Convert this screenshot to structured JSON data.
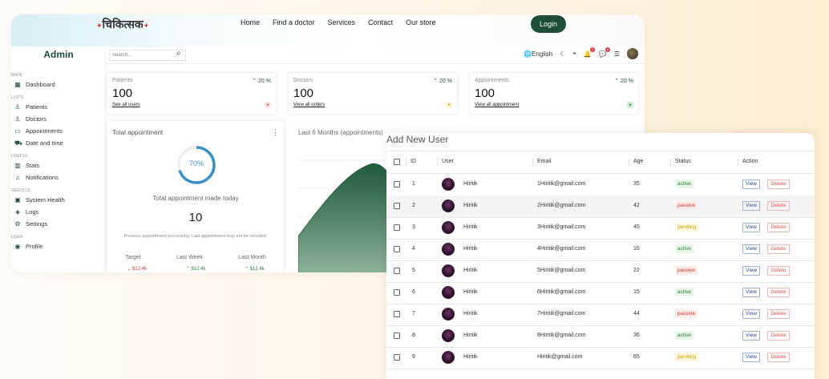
{
  "brand": {
    "logo": "चिकित्सक",
    "login": "Login"
  },
  "nav": [
    "Home",
    "Find a doctor",
    "Services",
    "Contact",
    "Our store"
  ],
  "sidebar": {
    "title": "Admin",
    "sections": [
      {
        "label": "MAIN",
        "items": [
          {
            "label": "Dashboard",
            "icon": "dashboard-icon"
          }
        ]
      },
      {
        "label": "LISTS",
        "items": [
          {
            "label": "Patients",
            "icon": "person-icon"
          },
          {
            "label": "Doctors",
            "icon": "doctor-icon"
          },
          {
            "label": "Appointments",
            "icon": "card-icon"
          },
          {
            "label": "Date and time",
            "icon": "truck-icon"
          }
        ]
      },
      {
        "label": "USEFUL",
        "items": [
          {
            "label": "Stats",
            "icon": "stats-icon"
          },
          {
            "label": "Notifications",
            "icon": "bell-icon"
          }
        ]
      },
      {
        "label": "SERVICE",
        "items": [
          {
            "label": "System Health",
            "icon": "health-icon"
          },
          {
            "label": "Logs",
            "icon": "logs-icon"
          },
          {
            "label": "Settings",
            "icon": "settings-icon"
          }
        ]
      },
      {
        "label": "USER",
        "items": [
          {
            "label": "Profile",
            "icon": "profile-icon"
          }
        ]
      }
    ]
  },
  "header": {
    "search_placeholder": "Search...",
    "language": "English",
    "notif_count": "1",
    "chat_count": "2"
  },
  "cards": [
    {
      "title": "Patients",
      "pct": "20 %",
      "value": "100",
      "link": "See all users",
      "color": "#e03a3a",
      "bg": "#fde3e3"
    },
    {
      "title": "Doctors",
      "pct": "20 %",
      "value": "100",
      "link": "View all orders",
      "color": "#c99a00",
      "bg": "#fff4d6"
    },
    {
      "title": "Appointments",
      "pct": "20 %",
      "value": "100",
      "link": "View all appointment",
      "color": "#2e7d32",
      "bg": "#c9ecd0"
    }
  ],
  "total": {
    "title": "Total appointment",
    "progress": "70%",
    "progress_value": 0.7,
    "made_today": "Total appointment made today",
    "count": "10",
    "note": "Previous appointment processing. Last appointment may not be included.",
    "cols": [
      "Target",
      "Last Week",
      "Last Month"
    ],
    "vals": [
      {
        "t": "$12.4k",
        "dir": "down"
      },
      {
        "t": "$12.4k",
        "dir": "up"
      },
      {
        "t": "$12.4k",
        "dir": "up"
      }
    ]
  },
  "chart": {
    "title": "Last 6 Months (appointments)"
  },
  "users": {
    "title": "Add New User",
    "headers": [
      "ID",
      "User",
      "Email",
      "Age",
      "Status",
      "Action"
    ],
    "view": "View",
    "delete": "Delete",
    "rows": [
      {
        "id": "1",
        "name": "Hiritik",
        "email": "1Hiritik@gmail.com",
        "age": "35",
        "status": "active"
      },
      {
        "id": "2",
        "name": "Hiritik",
        "email": "2Hiritik@gmail.com",
        "age": "42",
        "status": "passive"
      },
      {
        "id": "3",
        "name": "Hiritik",
        "email": "3Hiritik@gmail.com",
        "age": "45",
        "status": "pending"
      },
      {
        "id": "4",
        "name": "Hiritik",
        "email": "4Hiritik@gmail.com",
        "age": "16",
        "status": "active"
      },
      {
        "id": "5",
        "name": "Hiritik",
        "email": "5Hiritik@gmail.com",
        "age": "22",
        "status": "passive"
      },
      {
        "id": "6",
        "name": "Hiritik",
        "email": "6Hiritik@gmail.com",
        "age": "15",
        "status": "active"
      },
      {
        "id": "7",
        "name": "Hiritik",
        "email": "7Hiritik@gmail.com",
        "age": "44",
        "status": "passive"
      },
      {
        "id": "8",
        "name": "Hiritik",
        "email": "8Hiritik@gmail.com",
        "age": "36",
        "status": "active"
      },
      {
        "id": "9",
        "name": "Hiritik",
        "email": "Hiritik@gmail.com",
        "age": "65",
        "status": "pending"
      }
    ]
  }
}
